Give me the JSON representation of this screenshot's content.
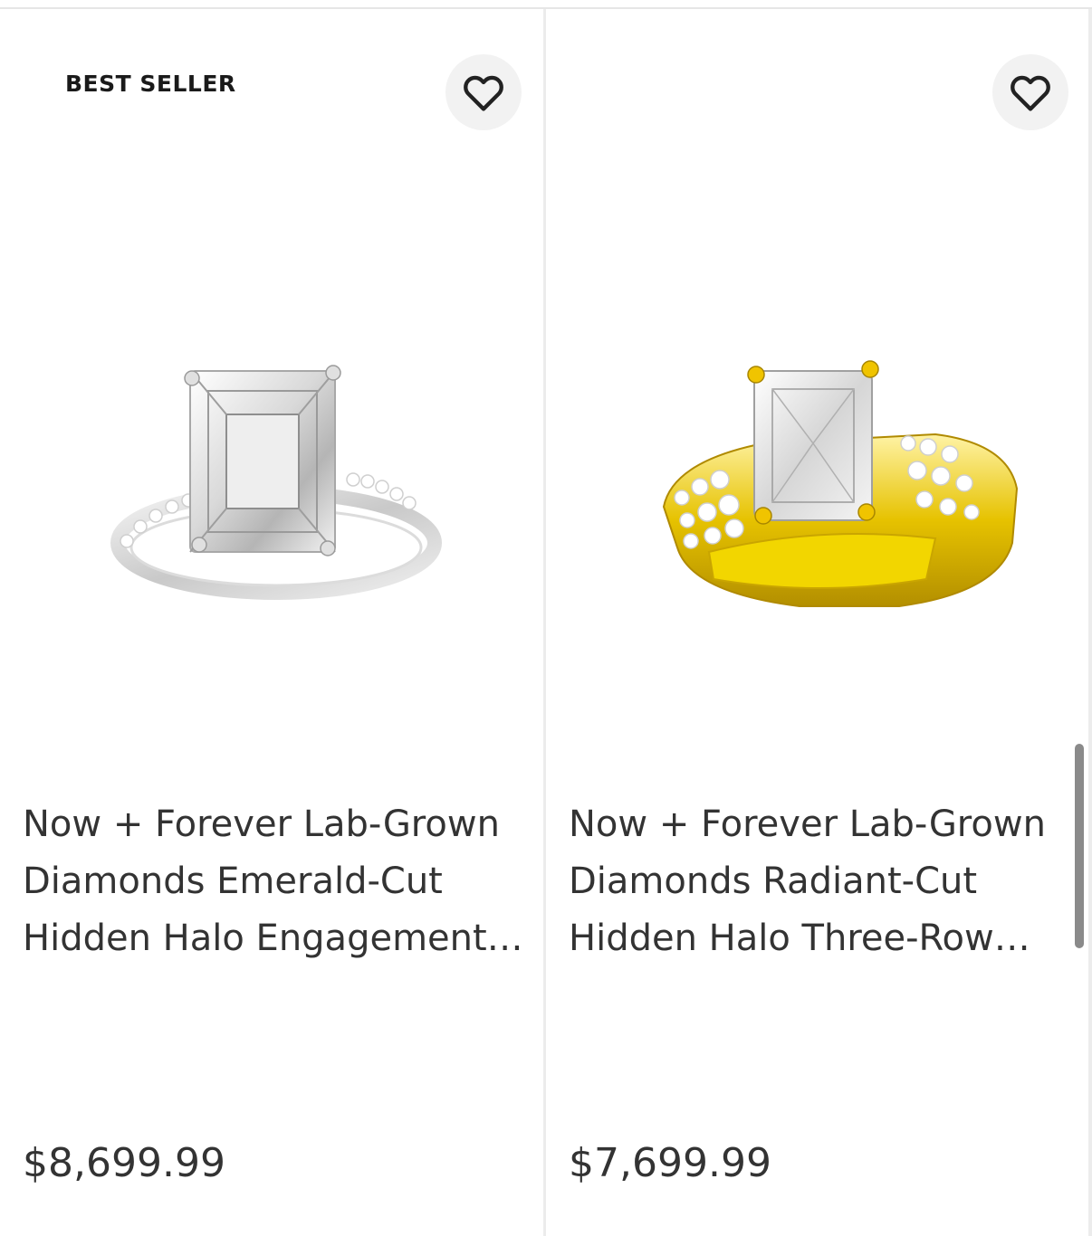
{
  "products": [
    {
      "badge": "BEST SELLER",
      "favorite_icon": "heart-outline-icon",
      "image": "emerald-cut-ring-white-gold",
      "title_lines": [
        "Now + Forever Lab-Grown",
        "Diamonds Emerald-Cut",
        "Hidden Halo Engagement…"
      ],
      "price": "$8,699.99"
    },
    {
      "badge": "",
      "favorite_icon": "heart-outline-icon",
      "image": "radiant-cut-ring-yellow-gold",
      "title_lines": [
        "Now + Forever Lab-Grown",
        "Diamonds Radiant-Cut",
        "Hidden Halo Three-Row…"
      ],
      "price": "$7,699.99"
    }
  ],
  "colors": {
    "text": "#333333",
    "favorite_bg": "#f2f2f2",
    "divider": "#ececec",
    "scrollbar": "#8a8a8a"
  }
}
